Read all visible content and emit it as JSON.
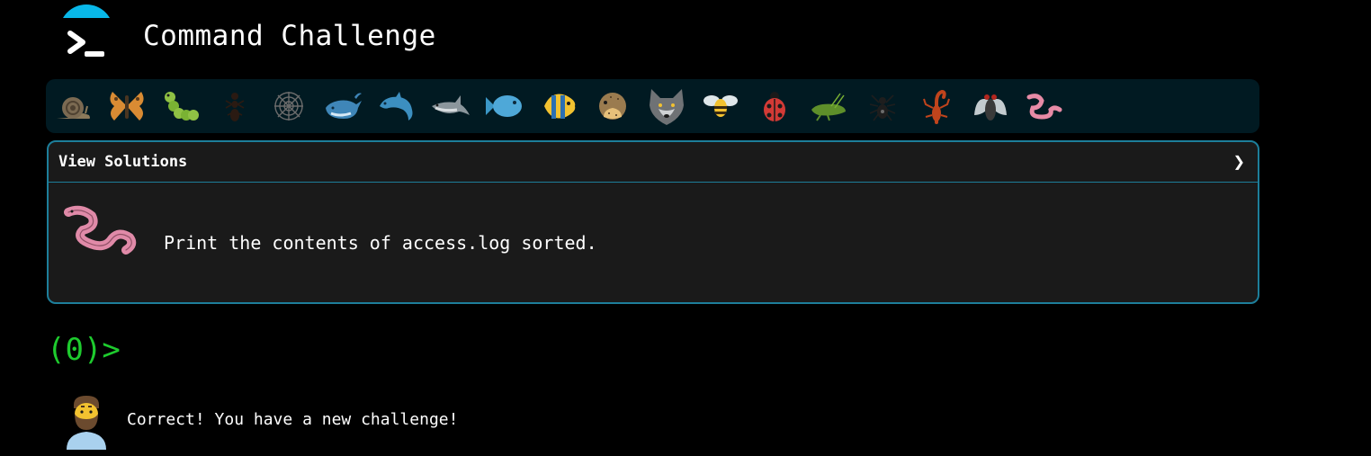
{
  "header": {
    "title": "Command Challenge",
    "logo_icon": "terminal-prompt-icon",
    "logo_accent": "#08b7e8"
  },
  "animals": [
    {
      "name": "snail-icon"
    },
    {
      "name": "butterfly-icon"
    },
    {
      "name": "caterpillar-icon"
    },
    {
      "name": "ant-icon"
    },
    {
      "name": "spider-web-icon"
    },
    {
      "name": "whale-icon"
    },
    {
      "name": "dolphin-icon"
    },
    {
      "name": "shark-icon"
    },
    {
      "name": "fish-icon"
    },
    {
      "name": "tropical-fish-icon"
    },
    {
      "name": "pufferfish-icon"
    },
    {
      "name": "wolf-icon"
    },
    {
      "name": "bee-icon"
    },
    {
      "name": "ladybug-icon"
    },
    {
      "name": "cricket-icon"
    },
    {
      "name": "spider-icon"
    },
    {
      "name": "scorpion-icon"
    },
    {
      "name": "fly-icon"
    },
    {
      "name": "worm-icon"
    }
  ],
  "panel": {
    "header_label": "View Solutions",
    "chevron": "❯",
    "task_icon": "worm-icon",
    "task_text": "Print the contents of access.log sorted."
  },
  "prompt": {
    "text": "(0)>"
  },
  "message": {
    "avatar_icon": "bearded-man-icon",
    "text": "Correct! You have a new challenge!"
  },
  "colors": {
    "background": "#000000",
    "strip_bg": "#011a22",
    "panel_bg": "#1a1a1a",
    "panel_border": "#1d7e9a",
    "prompt_green": "#1ecb2e"
  }
}
